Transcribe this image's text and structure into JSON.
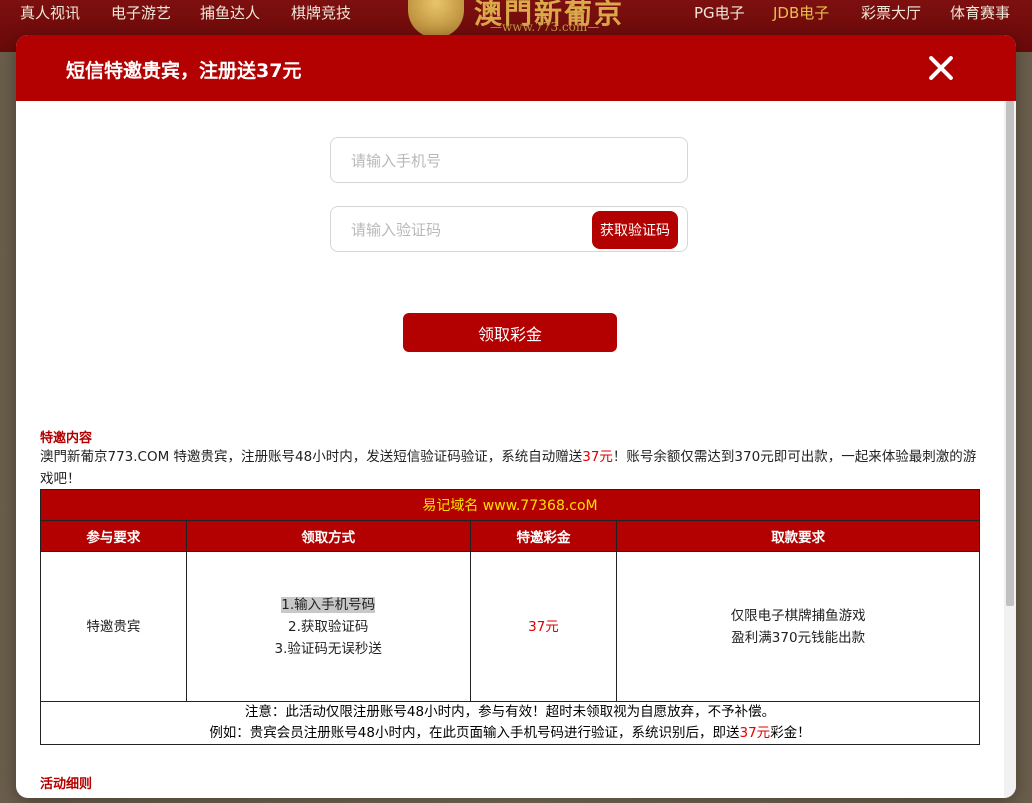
{
  "background": {
    "nav_left": [
      "真人视讯",
      "电子游艺",
      "捕鱼达人",
      "棋牌竞技"
    ],
    "nav_right": [
      "PG电子",
      "JDB电子",
      "彩票大厅",
      "体育赛事"
    ],
    "logo_name": "澳門新葡京",
    "logo_url": "—www.773.com—",
    "accent_color": "#e8c04a"
  },
  "modal": {
    "title": "短信特邀贵宾，注册送37元",
    "close_icon": "close-icon",
    "form": {
      "phone_placeholder": "请输入手机号",
      "code_placeholder": "请输入验证码",
      "get_code_label": "获取验证码",
      "claim_label": "领取彩金"
    },
    "content": {
      "section_title": "特邀内容",
      "intro_part1": "澳門新葡京773.COM 特邀贵宾，注册账号48小时内，发送短信验证码验证，系统自动赠送",
      "intro_amount": "37元",
      "intro_part2": "！账号余额仅需达到370元即可出款，一起来体验最刺激的游戏吧！"
    },
    "table": {
      "domain_label": "易记域名 www.77368.coM",
      "headers": [
        "参与要求",
        "领取方式",
        "特邀彩金",
        "取款要求"
      ],
      "row": {
        "requirement": "特邀贵宾",
        "steps": [
          "1.输入手机号码",
          "2.获取验证码",
          "3.验证码无误秒送"
        ],
        "bonus": "37元",
        "withdraw": [
          "仅限电子棋牌捕鱼游戏",
          "盈利满370元钱能出款"
        ]
      },
      "note1": "注意：此活动仅限注册账号48小时内，参与有效！超时未领取视为自愿放弃，不予补偿。",
      "note2_part1": "例如：贵宾会员注册账号48小时内，在此页面输入手机号码进行验证，系统识别后，即送",
      "note2_amount": "37元",
      "note2_part2": "彩金！"
    },
    "section_title_2": "活动细则"
  },
  "colors": {
    "primary_red": "#b30000",
    "highlight_red": "#e00000",
    "domain_yellow": "#ffe100"
  }
}
